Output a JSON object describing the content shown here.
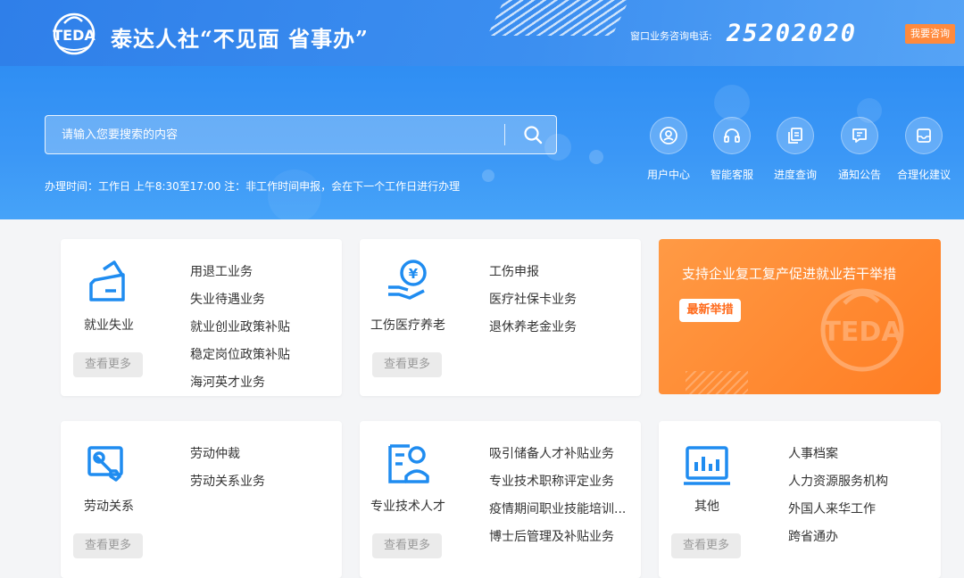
{
  "header": {
    "logo_text": "TEDA",
    "brand_title": "泰达人社“不见面 省事办”",
    "hotline_label": "窗口业务咨询电话:",
    "hotline_number": "25202020",
    "consult_button": "我要咨询",
    "accent_color": "#ff8a3d"
  },
  "search": {
    "placeholder": "请输入您要搜索的内容",
    "value": ""
  },
  "office_hours": "办理时间：工作日 上午8:30至17:00 注：非工作时间申报，会在下一个工作日进行办理",
  "quick_links": [
    {
      "label": "用户中心",
      "icon": "user-circle-icon"
    },
    {
      "label": "智能客服",
      "icon": "headset-icon"
    },
    {
      "label": "进度查询",
      "icon": "document-copy-icon"
    },
    {
      "label": "通知公告",
      "icon": "message-icon"
    },
    {
      "label": "合理化建议",
      "icon": "mail-icon"
    }
  ],
  "cards": [
    {
      "name": "就业失业",
      "icon": "wallet-card-icon",
      "more": "查看更多",
      "items": [
        "用退工业务",
        "失业待遇业务",
        "就业创业政策补贴",
        "稳定岗位政策补贴",
        "海河英才业务"
      ]
    },
    {
      "name": "工伤医疗养老",
      "icon": "hand-coin-icon",
      "more": "查看更多",
      "items": [
        "工伤申报",
        "医疗社保卡业务",
        "退休养老金业务"
      ]
    },
    {
      "name": "劳动关系",
      "icon": "wrench-screen-icon",
      "more": "查看更多",
      "items": [
        "劳动仲裁",
        "劳动关系业务"
      ]
    },
    {
      "name": "专业技术人才",
      "icon": "person-document-icon",
      "more": "查看更多",
      "items": [
        "吸引储备人才补贴业务",
        "专业技术职称评定业务",
        "疫情期间职业技能培训...",
        "博士后管理及补贴业务"
      ]
    },
    {
      "name": "其他",
      "icon": "bar-chart-icon",
      "more": "查看更多",
      "items": [
        "人事档案",
        "人力资源服务机构",
        "外国人来华工作",
        "跨省通办"
      ]
    }
  ],
  "promo": {
    "title": "支持企业复工复产促进就业若干举措",
    "tag": "最新举措",
    "watermark": "TEDA"
  }
}
